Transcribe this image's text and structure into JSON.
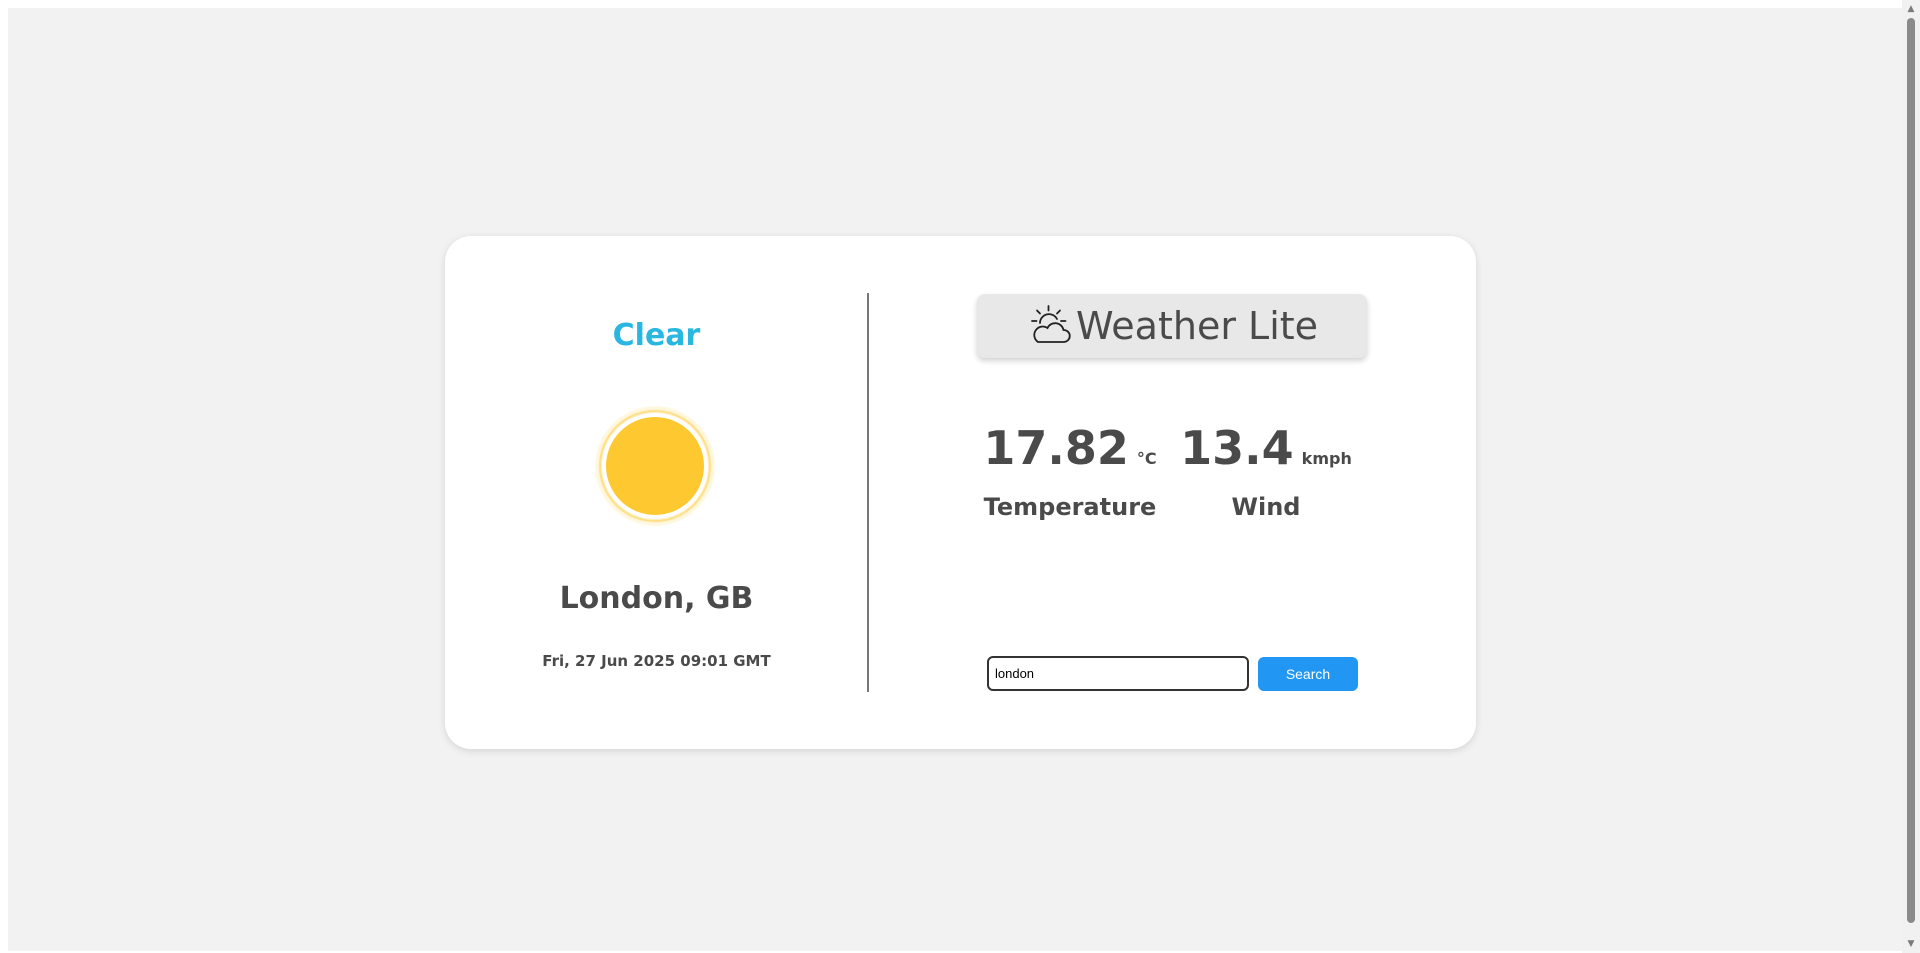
{
  "weather": {
    "condition": "Clear",
    "location": "London, GB",
    "datetime": "Fri, 27 Jun 2025 09:01 GMT"
  },
  "brand": {
    "title": "Weather Lite",
    "icon": "sun-behind-cloud-icon"
  },
  "stats": {
    "temperature": {
      "value": "17.82",
      "unit": "°C",
      "label": "Temperature"
    },
    "wind": {
      "value": "13.4",
      "unit": "kmph",
      "label": "Wind"
    }
  },
  "search": {
    "value": "london",
    "button_label": "Search"
  },
  "colors": {
    "background": "#f2f2f2",
    "card": "#ffffff",
    "accent": "#29b6e0",
    "sun": "#fec830",
    "button": "#2196f3",
    "text": "#4a4a4a"
  }
}
